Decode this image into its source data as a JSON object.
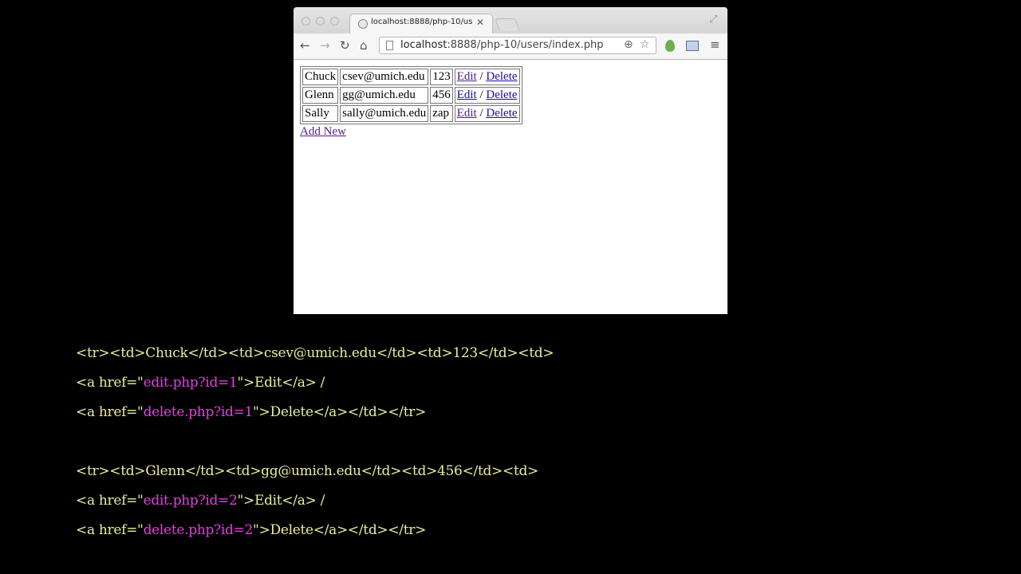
{
  "browser": {
    "tab_title": "localhost:8888/php-10/us",
    "tab_close": "✕",
    "url_host": "localhost",
    "url_rest": ":8888/php-10/users/index.php"
  },
  "table": {
    "rows": [
      {
        "name": "Chuck",
        "email": "csev@umich.edu",
        "password": "123",
        "edit": "Edit",
        "sep": "/",
        "delete": "Delete"
      },
      {
        "name": "Glenn",
        "email": "gg@umich.edu",
        "password": "456",
        "edit": "Edit",
        "sep": "/",
        "delete": "Delete"
      },
      {
        "name": "Sally",
        "email": "sally@umich.edu",
        "password": "zap",
        "edit": "Edit",
        "sep": "/",
        "delete": "Delete"
      }
    ]
  },
  "add_new": "Add New",
  "code": {
    "lines": [
      [
        {
          "t": "<tr><td>Chuck</td><td>csev@umich.edu</td><td>123</td><td>"
        }
      ],
      [
        {
          "t": "<a href=\""
        },
        {
          "t": "edit.php?id=1",
          "s": true
        },
        {
          "t": "\">Edit</a> /"
        }
      ],
      [
        {
          "t": "<a href=\""
        },
        {
          "t": "delete.php?id=1",
          "s": true
        },
        {
          "t": "\">Delete</a></td></tr>"
        }
      ],
      [
        {
          "t": ""
        }
      ],
      [
        {
          "t": "<tr><td>Glenn</td><td>gg@umich.edu</td><td>456</td><td>"
        }
      ],
      [
        {
          "t": "<a href=\""
        },
        {
          "t": "edit.php?id=2",
          "s": true
        },
        {
          "t": "\">Edit</a> /"
        }
      ],
      [
        {
          "t": "<a href=\""
        },
        {
          "t": "delete.php?id=2",
          "s": true
        },
        {
          "t": "\">Delete</a></td></tr>"
        }
      ]
    ]
  },
  "colors": {
    "code_text": "#ecec9c",
    "code_string": "#e040e0",
    "link": "#1a0dab",
    "visited_link": "#551a8b"
  }
}
